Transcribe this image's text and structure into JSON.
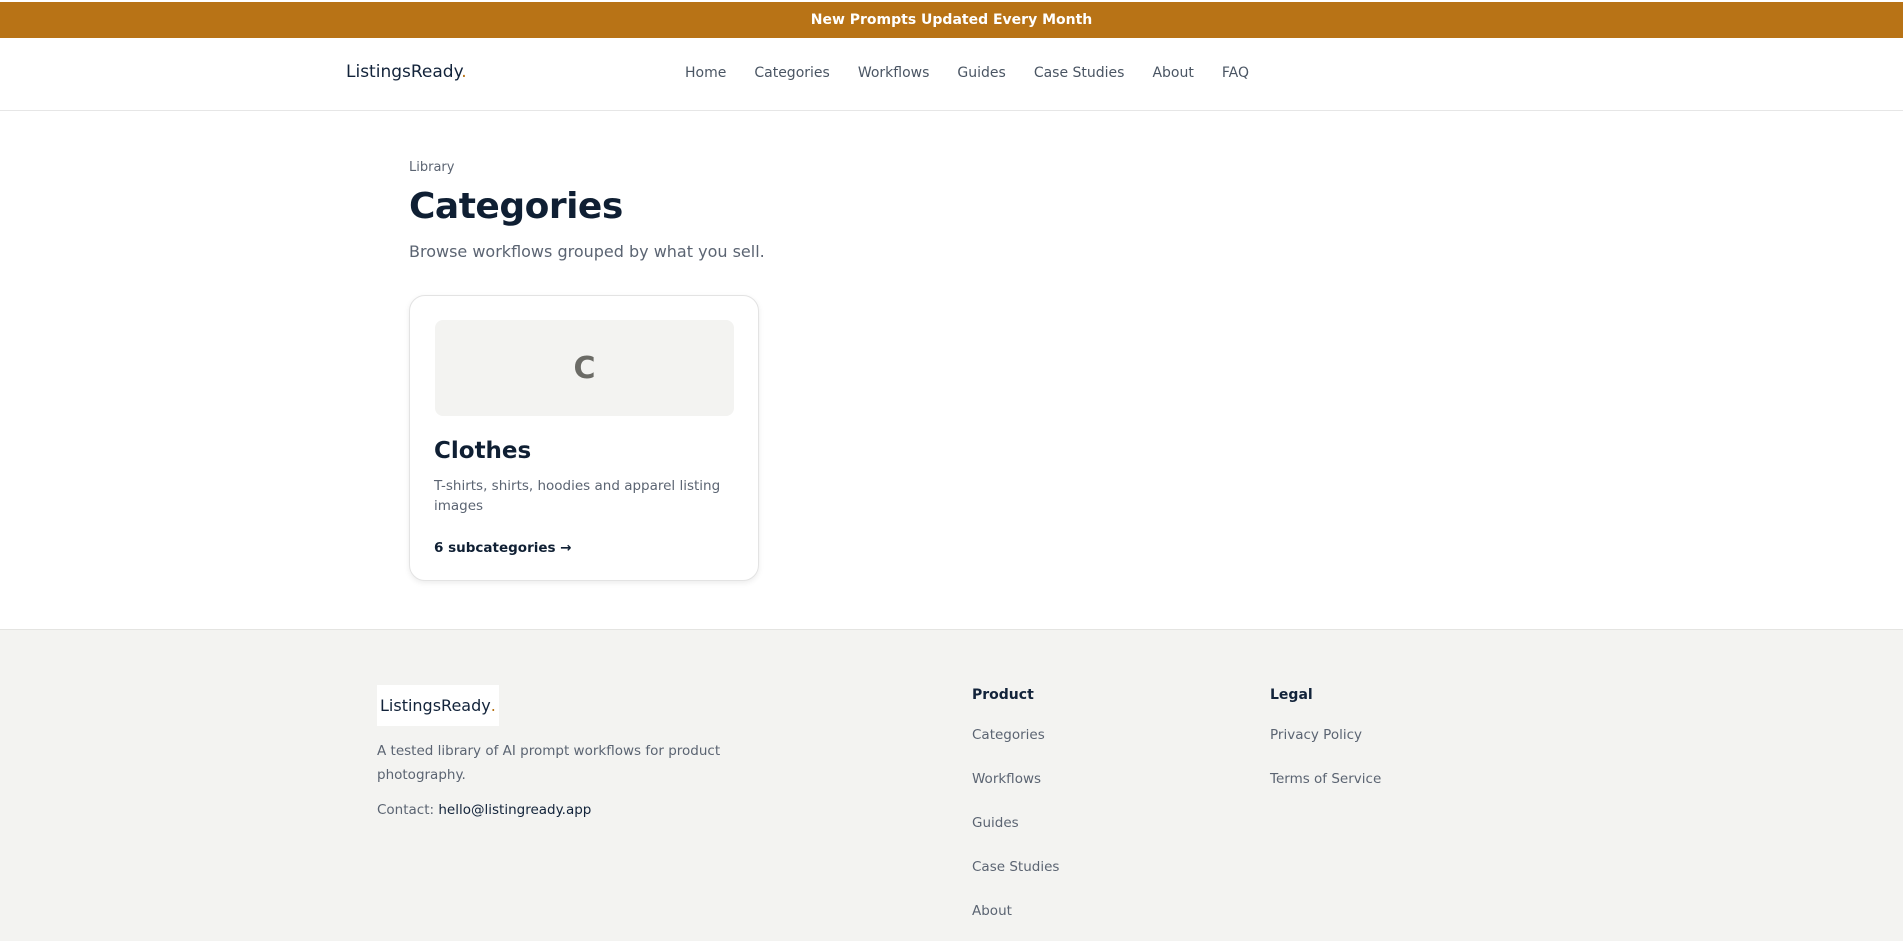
{
  "announcement": "New Prompts Updated Every Month",
  "header": {
    "logo_text": "ListingsReady",
    "logo_dot": ".",
    "nav": [
      "Home",
      "Categories",
      "Workflows",
      "Guides",
      "Case Studies",
      "About",
      "FAQ"
    ]
  },
  "main": {
    "eyebrow": "Library",
    "title": "Categories",
    "subtitle": "Browse workflows grouped by what you sell."
  },
  "cards": [
    {
      "thumb_letter": "C",
      "title": "Clothes",
      "description": "T-shirts, shirts, hoodies and apparel listing images",
      "link": "6 subcategories →"
    }
  ],
  "footer": {
    "logo_text": "ListingsReady",
    "logo_dot": ".",
    "about": "A tested library of AI prompt workflows for product photography.",
    "contact_label": "Contact:",
    "contact_email": "hello@listingready.app",
    "product_heading": "Product",
    "product_links": [
      "Categories",
      "Workflows",
      "Guides",
      "Case Studies",
      "About"
    ],
    "legal_heading": "Legal",
    "legal_links": [
      "Privacy Policy",
      "Terms of Service"
    ]
  },
  "colors": {
    "accent": "#b87316",
    "text_dark": "#0f1f33",
    "text_muted": "#5b6472",
    "footer_bg": "#f3f3f1"
  }
}
